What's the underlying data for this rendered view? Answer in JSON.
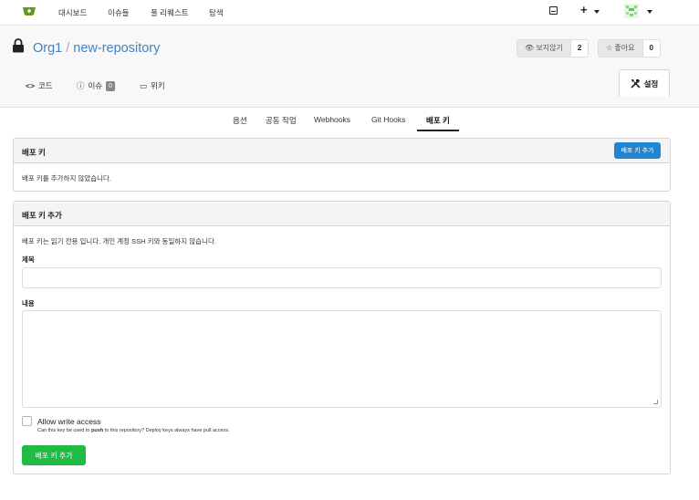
{
  "nav": {
    "items": [
      "대시보드",
      "이슈들",
      "풀 리퀘스트",
      "탐색"
    ]
  },
  "repo": {
    "owner": "Org1",
    "separator": "/",
    "name": "new-repository",
    "watch_label": "보지않기",
    "watch_count": "2",
    "star_label": "좋아요",
    "star_count": "0"
  },
  "tabs": {
    "code": "코드",
    "issues": "이슈",
    "issues_count": "0",
    "wiki": "위키",
    "settings": "설정"
  },
  "settings_menu": {
    "items": [
      "옵션",
      "공동 작업",
      "Webhooks",
      "Git Hooks",
      "배포 키"
    ],
    "active": "배포 키"
  },
  "deploy_keys": {
    "title": "배포 키",
    "add_button": "배포 키 추가",
    "empty_text": "배포 키를 추가하지 않았습니다."
  },
  "add_form": {
    "title": "배포 키 추가",
    "description": "배포 키는 읽기 전용 입니다. 개인 계정 SSH 키와 동일하지 않습니다.",
    "title_label": "제목",
    "title_value": "",
    "content_label": "내용",
    "content_value": "",
    "write_access_label": "Allow write access",
    "help_prefix": "Can this key be used to ",
    "help_bold": "push",
    "help_suffix": " to this repository? Deploy keys always have pull access.",
    "submit": "배포 키 추가",
    "write_access_checked": false
  },
  "colors": {
    "link": "#4183c4",
    "primary": "#2185d0",
    "positive": "#21ba45",
    "logo": "#609926"
  },
  "icons": [
    "gitea-logo-icon",
    "inbox-icon",
    "plus-icon",
    "lock-icon",
    "eye-icon",
    "star-icon",
    "code-icon",
    "issue-icon",
    "wiki-icon",
    "tools-icon"
  ]
}
